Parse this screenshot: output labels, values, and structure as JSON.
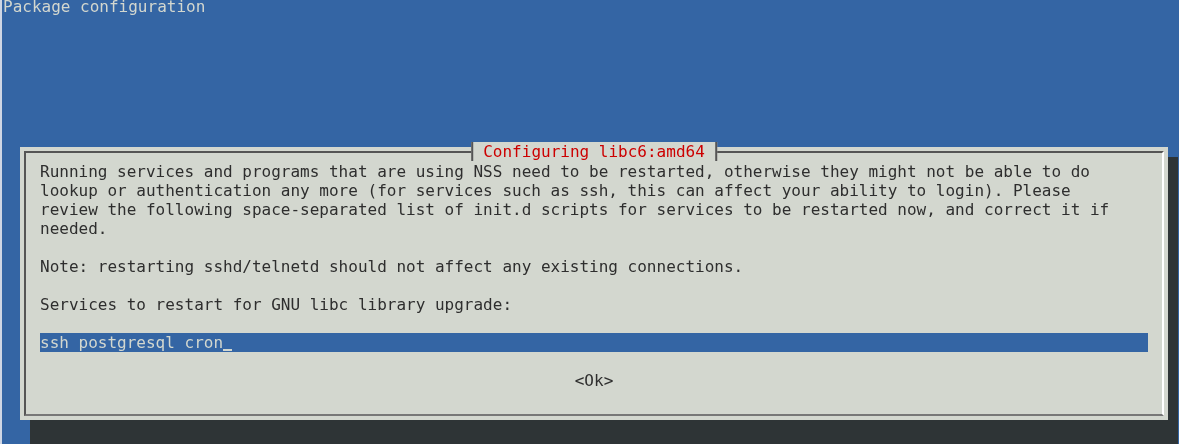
{
  "screen_title": "Package configuration",
  "dialog": {
    "title": "Configuring libc6:amd64",
    "paragraphs": [
      "Running services and programs that are using NSS need to be restarted, otherwise they might not be able to do lookup or authentication any more (for services such as ssh, this can affect your ability to login). Please review the following space-separated list of init.d scripts for services to be restarted now, and correct it if needed.",
      "Note: restarting sshd/telnetd should not affect any existing connections.",
      "Services to restart for GNU libc library upgrade:"
    ],
    "input": {
      "value": "ssh postgresql cron",
      "focused": true
    },
    "buttons": [
      {
        "label": "<Ok>",
        "selected": false
      }
    ]
  }
}
